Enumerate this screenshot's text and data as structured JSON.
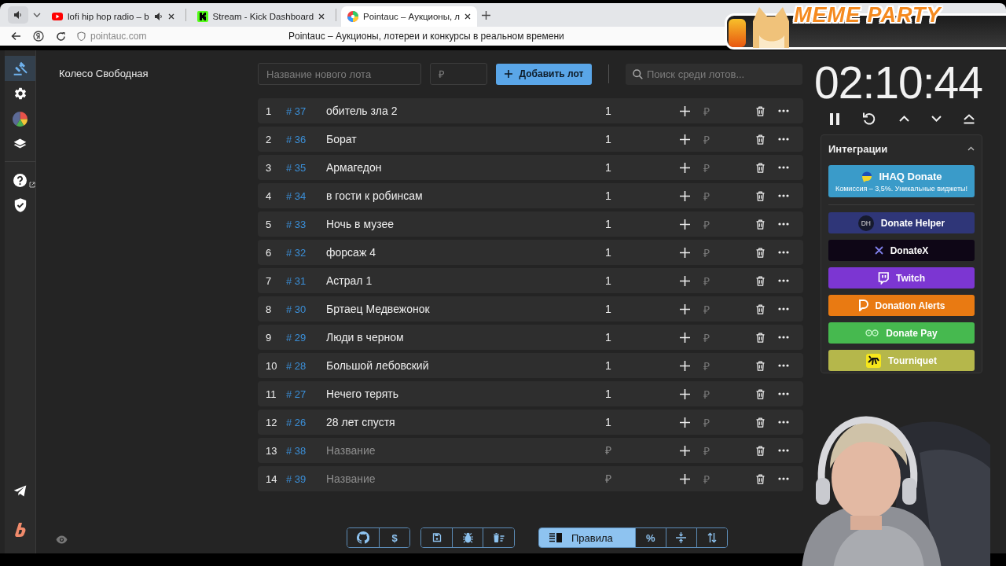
{
  "browser": {
    "tabs": [
      {
        "title": "lofi hip hop radio – b",
        "selected": false,
        "audio": true
      },
      {
        "title": "Stream - Kick Dashboard",
        "selected": false,
        "audio": false
      },
      {
        "title": "Pointauc – Аукционы, л",
        "selected": true,
        "audio": false
      }
    ],
    "address": "pointauc.com",
    "page_title": "Pointauc – Аукционы, лотереи и конкурсы в реальном времени"
  },
  "overlay": {
    "title": "MEME PARTY"
  },
  "sidebar": {
    "items": [
      {
        "selected": true
      },
      {
        "selected": false
      },
      {
        "selected": false
      },
      {
        "selected": false
      },
      {
        "selected": false
      },
      {
        "selected": false
      },
      {
        "selected": false
      },
      {
        "selected": false
      }
    ]
  },
  "page": {
    "title": "Колесо Свободная"
  },
  "new_lot": {
    "name_placeholder": "Название нового лота",
    "amount_placeholder": "₽",
    "add_button": "Добавить лот",
    "search_placeholder": "Поиск среди лотов..."
  },
  "lots": [
    {
      "index": "1",
      "number": "# 37",
      "name": "обитель зла 2",
      "amount": "1",
      "currency": "₽"
    },
    {
      "index": "2",
      "number": "# 36",
      "name": "Борат",
      "amount": "1",
      "currency": "₽"
    },
    {
      "index": "3",
      "number": "# 35",
      "name": "Армагедон",
      "amount": "1",
      "currency": "₽"
    },
    {
      "index": "4",
      "number": "# 34",
      "name": "в гости к робинсам",
      "amount": "1",
      "currency": "₽"
    },
    {
      "index": "5",
      "number": "# 33",
      "name": "Ночь в музее",
      "amount": "1",
      "currency": "₽"
    },
    {
      "index": "6",
      "number": "# 32",
      "name": "форсаж 4",
      "amount": "1",
      "currency": "₽"
    },
    {
      "index": "7",
      "number": "# 31",
      "name": "Астрал 1",
      "amount": "1",
      "currency": "₽"
    },
    {
      "index": "8",
      "number": "# 30",
      "name": "Бртаец Медвежонок",
      "amount": "1",
      "currency": "₽"
    },
    {
      "index": "9",
      "number": "# 29",
      "name": "Люди в черном",
      "amount": "1",
      "currency": "₽"
    },
    {
      "index": "10",
      "number": "# 28",
      "name": "Большой лебовский",
      "amount": "1",
      "currency": "₽"
    },
    {
      "index": "11",
      "number": "# 27",
      "name": "Нечего терять",
      "amount": "1",
      "currency": "₽"
    },
    {
      "index": "12",
      "number": "# 26",
      "name": "28 лет спустя",
      "amount": "1",
      "currency": "₽"
    },
    {
      "index": "13",
      "number": "# 38",
      "name_placeholder": "Название",
      "amount_placeholder": "₽",
      "currency": "₽"
    },
    {
      "index": "14",
      "number": "# 39",
      "name_placeholder": "Название",
      "amount_placeholder": "₽",
      "currency": "₽"
    }
  ],
  "timer": {
    "time": "02:10:44"
  },
  "integrations": {
    "title": "Интеграции",
    "expanded": true,
    "items": [
      {
        "name": "IHAQ Donate",
        "subtitle": "Комиссия – 3,5%. Уникальные виджеты!",
        "color": "#3a9bc9"
      },
      {
        "name": "Donate Helper",
        "badge": "DH",
        "color": "#2f3678"
      },
      {
        "name": "DonateX",
        "color": "#0e0616"
      },
      {
        "name": "Twitch",
        "color": "#7c36d2"
      },
      {
        "name": "Donation Alerts",
        "color": "#e97a12"
      },
      {
        "name": "Donate Pay",
        "color": "#46b94f"
      },
      {
        "name": "Tourniquet",
        "color": "#b5b74b"
      }
    ]
  },
  "toolbar": {
    "groups": [
      [
        {
          "selected": false
        },
        {
          "label": "$",
          "selected": false
        }
      ],
      [
        {
          "selected": false
        },
        {
          "selected": false
        },
        {
          "selected": false
        }
      ],
      [
        {
          "label": "Правила",
          "selected": true
        },
        {
          "label": "%",
          "selected": false
        },
        {
          "selected": false
        },
        {
          "selected": false
        }
      ]
    ]
  }
}
